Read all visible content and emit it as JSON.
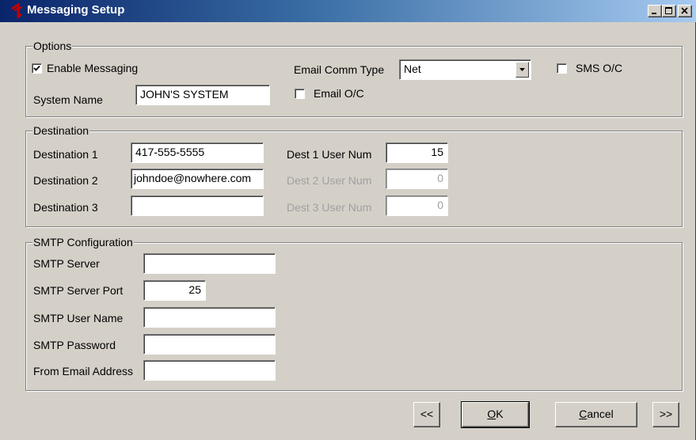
{
  "window": {
    "title": "Messaging Setup"
  },
  "options": {
    "group_label": "Options",
    "enable_messaging_label": "Enable Messaging",
    "enable_messaging_checked": true,
    "system_name_label": "System Name",
    "system_name_value": "JOHN'S SYSTEM",
    "email_comm_type_label": "Email Comm Type",
    "email_comm_type_value": "Net",
    "email_oc_label": "Email O/C",
    "email_oc_checked": false,
    "sms_oc_label": "SMS O/C",
    "sms_oc_checked": false
  },
  "destination": {
    "group_label": "Destination",
    "rows": [
      {
        "label": "Destination 1",
        "value": "417-555-5555",
        "user_num_label": "Dest 1 User Num",
        "user_num": "15",
        "enabled": true
      },
      {
        "label": "Destination 2",
        "value": "johndoe@nowhere.com",
        "user_num_label": "Dest 2 User Num",
        "user_num": "0",
        "enabled": false
      },
      {
        "label": "Destination 3",
        "value": "",
        "user_num_label": "Dest 3 User Num",
        "user_num": "0",
        "enabled": false
      }
    ]
  },
  "smtp": {
    "group_label": "SMTP Configuration",
    "server_label": "SMTP Server",
    "server_value": "",
    "port_label": "SMTP Server Port",
    "port_value": "25",
    "user_label": "SMTP User Name",
    "user_value": "",
    "password_label": "SMTP Password",
    "password_value": "",
    "from_label": "From Email Address",
    "from_value": ""
  },
  "buttons": {
    "prev": "<<",
    "ok_accel": "O",
    "ok_rest": "K",
    "cancel_accel": "C",
    "cancel_rest": "ancel",
    "next": ">>"
  }
}
